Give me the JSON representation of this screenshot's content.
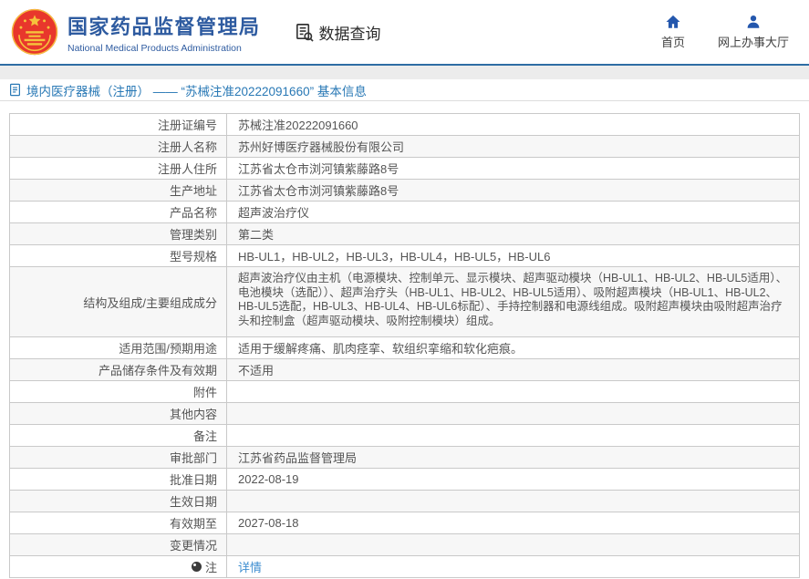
{
  "header": {
    "logo_title": "国家药品监督管理局",
    "logo_subtitle": "National Medical Products Administration",
    "section_title": "数据查询",
    "nav": [
      {
        "label": "首页"
      },
      {
        "label": "网上办事大厅"
      }
    ]
  },
  "breadcrumb": {
    "text": "境内医疗器械（注册） —— “苏械注准20222091660” 基本信息"
  },
  "table": {
    "rows": [
      {
        "label": "注册证编号",
        "value": "苏械注准20222091660"
      },
      {
        "label": "注册人名称",
        "value": "苏州好博医疗器械股份有限公司"
      },
      {
        "label": "注册人住所",
        "value": "江苏省太仓市浏河镇紫藤路8号"
      },
      {
        "label": "生产地址",
        "value": "江苏省太仓市浏河镇紫藤路8号"
      },
      {
        "label": "产品名称",
        "value": "超声波治疗仪"
      },
      {
        "label": "管理类别",
        "value": "第二类"
      },
      {
        "label": "型号规格",
        "value": "HB-UL1，HB-UL2，HB-UL3，HB-UL4，HB-UL5，HB-UL6"
      },
      {
        "label": "结构及组成/主要组成成分",
        "value": "超声波治疗仪由主机（电源模块、控制单元、显示模块、超声驱动模块（HB-UL1、HB-UL2、HB-UL5适用）、电池模块（选配））、超声治疗头（HB-UL1、HB-UL2、HB-UL5适用）、吸附超声模块（HB-UL1、HB-UL2、HB-UL5选配，HB-UL3、HB-UL4、HB-UL6标配）、手持控制器和电源线组成。吸附超声模块由吸附超声治疗头和控制盒（超声驱动模块、吸附控制模块）组成。"
      },
      {
        "label": "适用范围/预期用途",
        "value": "适用于缓解疼痛、肌肉痉挛、软组织挛缩和软化疤痕。"
      },
      {
        "label": "产品储存条件及有效期",
        "value": "不适用"
      },
      {
        "label": "附件",
        "value": ""
      },
      {
        "label": "其他内容",
        "value": ""
      },
      {
        "label": "备注",
        "value": ""
      },
      {
        "label": "审批部门",
        "value": "江苏省药品监督管理局"
      },
      {
        "label": "批准日期",
        "value": "2022-08-19"
      },
      {
        "label": "生效日期",
        "value": ""
      },
      {
        "label": "有效期至",
        "value": "2027-08-18"
      },
      {
        "label": "变更情况",
        "value": ""
      },
      {
        "label": "注",
        "value": "详情"
      }
    ]
  },
  "colors": {
    "brand_blue": "#2e5ba0",
    "header_line_blue": "#2e6da4",
    "breadcrumb_blue": "#2878b5",
    "link_blue": "#3e8ed0",
    "nav_icon_blue": "#2457ad",
    "emblem_red": "#e8372c",
    "emblem_gold": "#f5c33c"
  }
}
